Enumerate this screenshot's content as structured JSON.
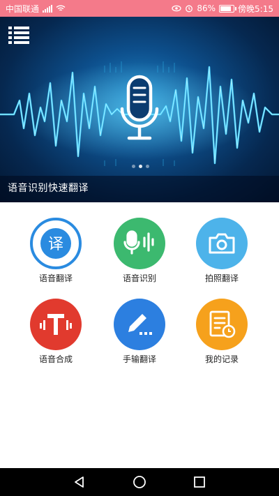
{
  "status_bar": {
    "carrier": "中国联通",
    "network_tag": "⁴ᴳ",
    "battery": "86%",
    "time": "傍晚5:15",
    "battery_level": 0.86
  },
  "banner": {
    "caption": "语音识别快速翻译",
    "slide_count": 3,
    "active_slide": 1
  },
  "features": [
    {
      "label": "语音翻译",
      "icon": "translate-icon",
      "color": "#ffffff",
      "ring": "#2a8be0",
      "glyph": "译"
    },
    {
      "label": "语音识别",
      "icon": "mic-wave-icon",
      "color": "#3cb96f"
    },
    {
      "label": "拍照翻译",
      "icon": "camera-icon",
      "color": "#4db3ea"
    },
    {
      "label": "语音合成",
      "icon": "text-speech-icon",
      "color": "#e13a2e"
    },
    {
      "label": "手输翻译",
      "icon": "pencil-icon",
      "color": "#2c7fe0"
    },
    {
      "label": "我的记录",
      "icon": "record-icon",
      "color": "#f6a11c"
    }
  ],
  "colors": {
    "status_bar": "#f47a8a",
    "banner_accent": "#3fd0ff",
    "nav_bar": "#000000"
  }
}
